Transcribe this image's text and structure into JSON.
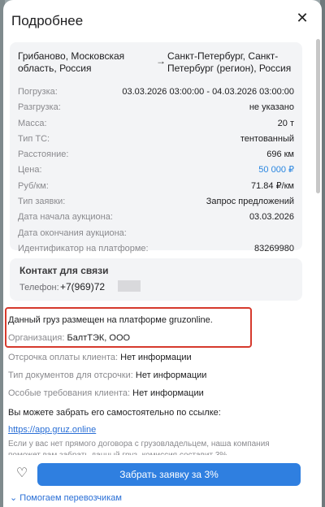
{
  "modal": {
    "title": "Подробнее",
    "close_icon": "close-icon"
  },
  "route": {
    "from": "Грибаново, Московская область, Россия",
    "arrow": "→",
    "to": "Санкт-Петербург, Санкт-Петербург (регион), Россия"
  },
  "details": [
    {
      "label": "Погрузка:",
      "value": "03.03.2026 03:00:00 - 04.03.2026 03:00:00"
    },
    {
      "label": "Разгрузка:",
      "value": "не указано"
    },
    {
      "label": "Масса:",
      "value": "20 т"
    },
    {
      "label": "Тип ТС:",
      "value": "тентованный"
    },
    {
      "label": "Расстояние:",
      "value": "696 км"
    },
    {
      "label": "Цена:",
      "value": "50 000 ₽"
    },
    {
      "label": "Руб/км:",
      "value": "71.84 ₽/км"
    },
    {
      "label": "Тип заявки:",
      "value": "Запрос предложений"
    },
    {
      "label": "Дата начала аукциона:",
      "value": "03.03.2026"
    },
    {
      "label": "Дата окончания аукциона:",
      "value": ""
    },
    {
      "label": "Идентификатор на платформе:",
      "value": "83269980"
    }
  ],
  "contact": {
    "title": "Контакт для связи",
    "phone_label": "Телефон:",
    "phone_value": "+7(969)72"
  },
  "info": {
    "platform_text": "Данный груз размещен на платформе gruzonline.",
    "org_label": "Организация:",
    "org_value": "БалтТЭК, ООО",
    "payment_label": "Отсрочка оплаты клиента:",
    "payment_value": "Нет информации",
    "docs_label": "Тип документов для отсрочки:",
    "docs_value": "Нет информации",
    "req_label": "Особые требования клиента:",
    "req_value": "Нет информации",
    "self_pickup": "Вы можете забрать его самостоятельно по ссылке:",
    "link": "https://app.gruz.online",
    "note": "Если у вас нет прямого договора с грузовладельцем, наша компания поможет вам забрать данный груз, комиссия составит 3%"
  },
  "footer": {
    "heart_icon": "heart-icon",
    "cta_label": "Забрать заявку за 3%",
    "help_icon": "chevron-down-icon",
    "help_label": "Помогаем перевозчикам"
  },
  "colors": {
    "accent": "#2f7fe0",
    "price": "#2a86e0",
    "highlight_border": "#d63a2d"
  }
}
